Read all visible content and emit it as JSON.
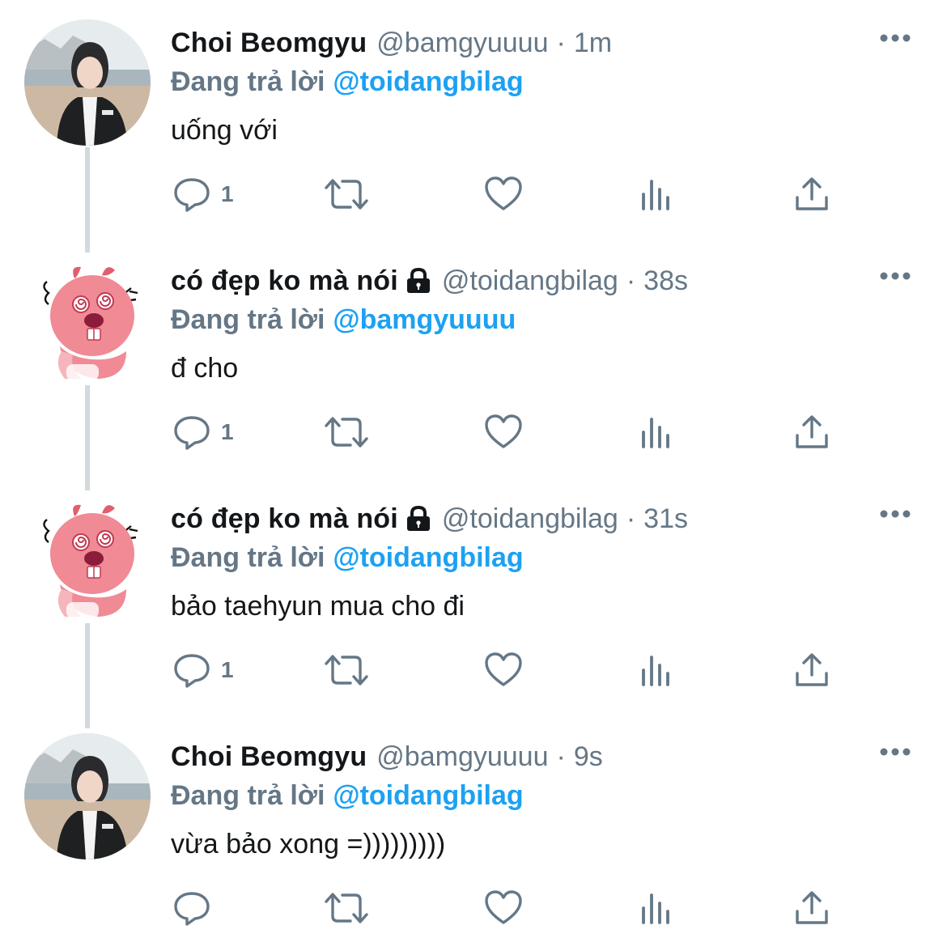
{
  "tweets": [
    {
      "display_name": "Choi Beomgyu",
      "locked": false,
      "handle": "@bamgyuuuu",
      "separator": "·",
      "time": "1m",
      "reply_prefix": "Đang trả lời",
      "reply_to": "@toidangbilag",
      "text": "uống với",
      "reply_count": "1",
      "avatar": "photo-avatar"
    },
    {
      "display_name": "có đẹp ko mà nói",
      "locked": true,
      "handle": "@toidangbilag",
      "separator": "·",
      "time": "38s",
      "reply_prefix": "Đang trả lời",
      "reply_to": "@bamgyuuuu",
      "text": "đ cho",
      "reply_count": "1",
      "avatar": "pink-beaver-avatar"
    },
    {
      "display_name": "có đẹp ko mà nói",
      "locked": true,
      "handle": "@toidangbilag",
      "separator": "·",
      "time": "31s",
      "reply_prefix": "Đang trả lời",
      "reply_to": "@toidangbilag",
      "text": "bảo taehyun mua cho đi",
      "reply_count": "1",
      "avatar": "pink-beaver-avatar"
    },
    {
      "display_name": "Choi Beomgyu",
      "locked": false,
      "handle": "@bamgyuuuu",
      "separator": "·",
      "time": "9s",
      "reply_prefix": "Đang trả lời",
      "reply_to": "@toidangbilag",
      "text": "vừa bảo xong =)))))))))",
      "reply_count": "",
      "avatar": "photo-avatar"
    }
  ],
  "icons": {
    "reply": "reply-icon",
    "retweet": "retweet-icon",
    "like": "heart-icon",
    "views": "views-icon",
    "share": "share-icon",
    "more": "more-icon",
    "lock": "lock-icon"
  },
  "colors": {
    "text": "#14171a",
    "secondary": "#657786",
    "link": "#1da1f2",
    "thread_line": "#d4d9de"
  }
}
